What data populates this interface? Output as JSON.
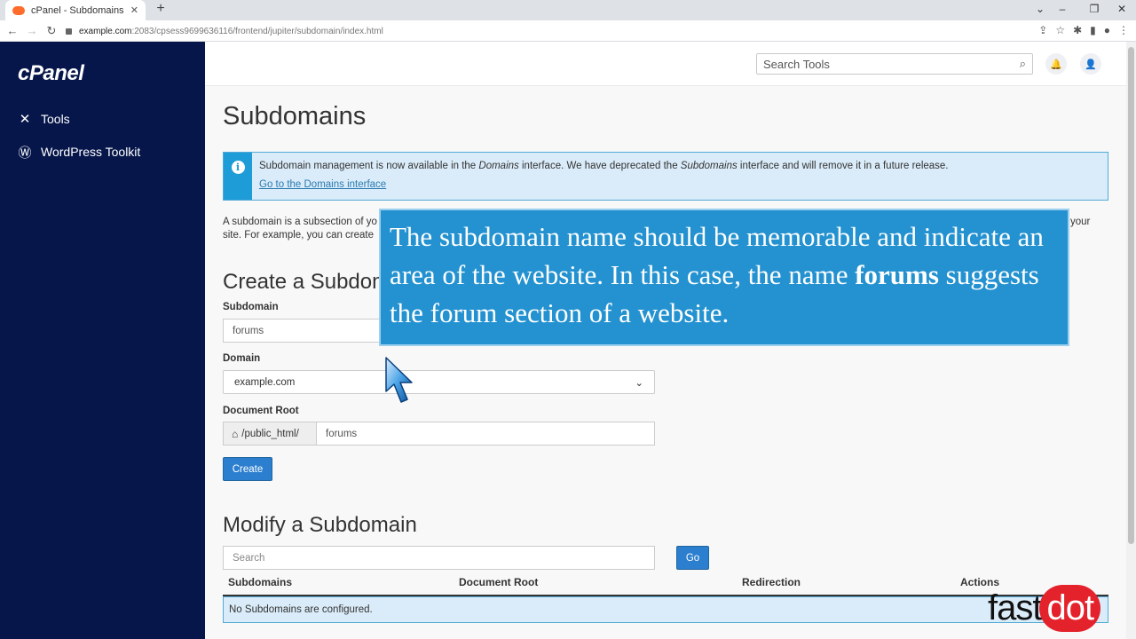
{
  "browser": {
    "tab_title": "cPanel - Subdomains",
    "tab_close": "✕",
    "new_tab": "+",
    "url_host": "example.com",
    "url_path": ":2083/cpsess9699636116/frontend/jupiter/subdomain/index.html"
  },
  "sidebar": {
    "logo": "cPanel",
    "items": [
      {
        "label": "Tools",
        "icon": "tools-icon"
      },
      {
        "label": "WordPress Toolkit",
        "icon": "wordpress-icon"
      }
    ]
  },
  "topbar": {
    "search_placeholder": "Search Tools"
  },
  "page": {
    "title": "Subdomains",
    "alert": {
      "text_1": "Subdomain management is now available in the ",
      "domains_italic": "Domains",
      "text_2": " interface. We have deprecated the ",
      "subdomains_italic": "Subdomains",
      "text_3": " interface and will remove it in a future release.",
      "link": "Go to the Domains interface"
    },
    "intro_line_1": "A subdomain is a subsection of yo",
    "intro_line_1_end": "your",
    "intro_line_2": "site. For example, you can create"
  },
  "create": {
    "title": "Create a Subdomain",
    "subdomain_label": "Subdomain",
    "subdomain_value": "forums",
    "domain_label": "Domain",
    "domain_value": "example.com",
    "docroot_label": "Document Root",
    "docroot_prefix": "/public_html/",
    "docroot_value": "forums",
    "create_button": "Create"
  },
  "modify": {
    "title": "Modify a Subdomain",
    "search_placeholder": "Search",
    "go_button": "Go",
    "columns": [
      "Subdomains",
      "Document Root",
      "Redirection",
      "Actions"
    ],
    "empty_message": "No Subdomains are configured."
  },
  "caption": {
    "part_1": "The subdomain name should be memorable and indicate an area of the website. In this case, the name ",
    "bold": "forums",
    "part_2": " suggests the forum section of a website."
  },
  "watermark": {
    "part_1": "fast",
    "part_2": "dot"
  }
}
